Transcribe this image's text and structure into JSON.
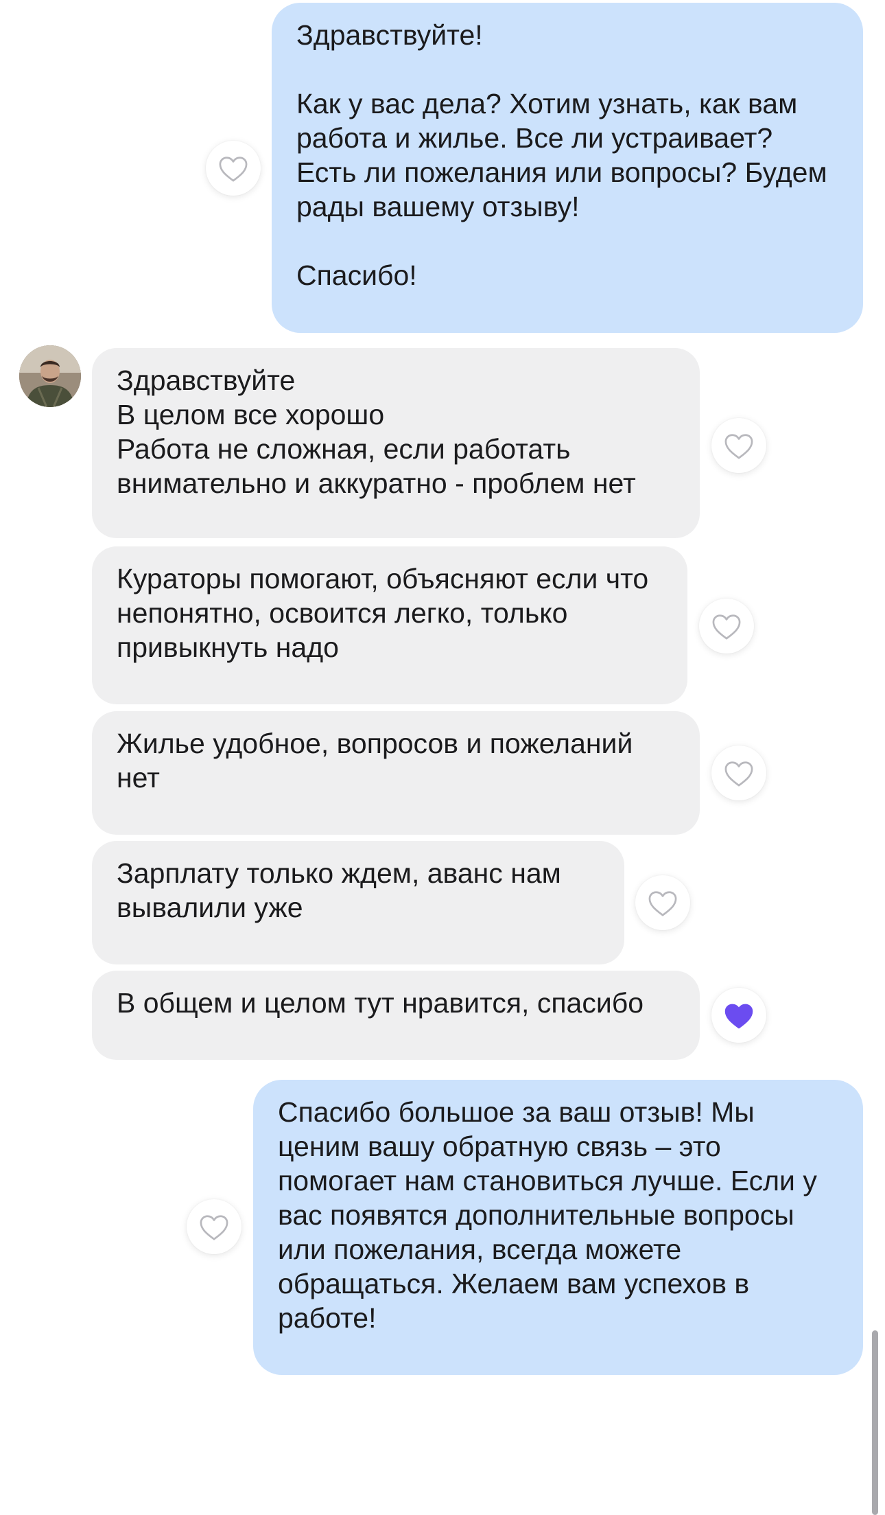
{
  "colors": {
    "outgoing_bubble": "#cce2fc",
    "incoming_bubble": "#efeff0",
    "like_active": "#6b4cf0",
    "like_inactive": "#b8b8bd"
  },
  "messages": [
    {
      "direction": "outgoing",
      "text": "Здравствуйте!\n\nКак у вас дела? Хотим узнать, как вам работа и жилье. Все ли устраивает? Есть ли пожелания или вопросы? Будем рады вашему отзыву!\n\nСпасибо!",
      "liked": false,
      "like_icon": "heart-outline-icon"
    },
    {
      "direction": "incoming",
      "text": "Здравствуйте\nВ целом все хорошо\nРабота не сложная, если работать внимательно и аккуратно - проблем нет",
      "liked": false,
      "like_icon": "heart-outline-icon"
    },
    {
      "direction": "incoming",
      "text": "Кураторы помогают, объясняют если что непонятно, освоится легко, только привыкнуть надо",
      "liked": false,
      "like_icon": "heart-outline-icon"
    },
    {
      "direction": "incoming",
      "text": "Жилье удобное, вопросов и пожеланий нет",
      "liked": false,
      "like_icon": "heart-outline-icon"
    },
    {
      "direction": "incoming",
      "text": "Зарплату только ждем, аванс нам вывалили уже",
      "liked": false,
      "like_icon": "heart-outline-icon"
    },
    {
      "direction": "incoming",
      "text": "В общем и целом тут нравится, спасибо",
      "liked": true,
      "like_icon": "heart-filled-icon"
    },
    {
      "direction": "outgoing",
      "text": "Спасибо большое за ваш отзыв! Мы ценим вашу обратную связь – это помогает нам становиться лучше. Если у вас появятся дополнительные вопросы или пожелания, всегда можете обращаться. Желаем вам успехов в работе!",
      "liked": false,
      "like_icon": "heart-outline-icon"
    }
  ]
}
